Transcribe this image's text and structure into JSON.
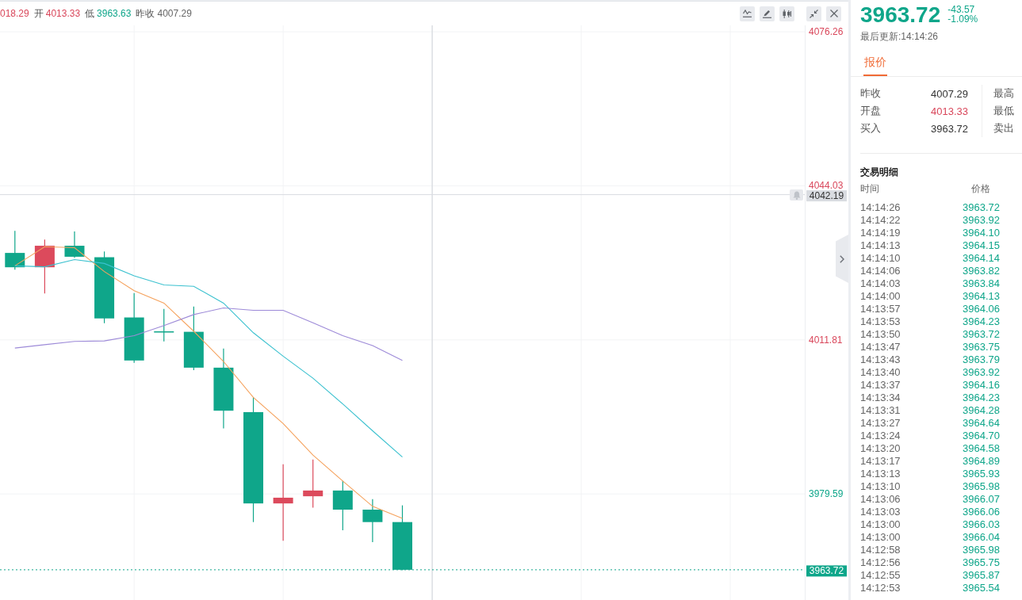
{
  "chart": {
    "quote_bar": [
      {
        "value": "018.29",
        "color": "#d9475b"
      },
      {
        "label": "开",
        "value": "4013.33",
        "color": "#d9475b"
      },
      {
        "label": "低",
        "value": "3963.63",
        "color": "#0fa68a"
      },
      {
        "label": "昨收",
        "value": "4007.29",
        "color": "#666666"
      }
    ],
    "chart_data": [
      {
        "type": "candlestick",
        "categories": [
          null,
          null,
          null,
          null,
          null,
          null,
          null,
          null,
          null,
          null,
          null,
          null,
          null,
          null,
          null,
          null,
          null,
          null,
          null,
          null,
          null,
          null,
          null,
          null,
          null,
          null,
          null
        ],
        "ohlc": [
          [
            4030.0,
            4034.6,
            4026.5,
            4027.0
          ],
          [
            4027.0,
            4032.8,
            4021.5,
            4031.5
          ],
          [
            4031.5,
            4034.5,
            4029.0,
            4029.2
          ],
          [
            4029.1,
            4030.3,
            4015.3,
            4016.3
          ],
          [
            4016.5,
            4021.6,
            4007.0,
            4007.5
          ],
          [
            4013.6,
            4018.3,
            4011.5,
            4013.5
          ],
          [
            4013.5,
            4018.8,
            4005.5,
            4006.0
          ],
          [
            4006.0,
            4010.0,
            3993.3,
            3997.0
          ],
          [
            3996.7,
            3999.8,
            3973.7,
            3977.6
          ],
          [
            3977.6,
            3985.8,
            3969.8,
            3978.8
          ],
          [
            3979.1,
            3986.8,
            3976.7,
            3980.3
          ],
          [
            3980.3,
            3982.3,
            3972.0,
            3976.3
          ],
          [
            3976.3,
            3978.5,
            3969.5,
            3973.7
          ],
          [
            3973.7,
            3977.2,
            3963.63,
            3963.72
          ],
          null,
          null,
          null,
          null,
          null,
          null,
          null,
          null,
          null,
          null,
          null,
          null,
          null
        ],
        "series": [
          {
            "type": "line",
            "color": "#f5a25d",
            "values": [
              4027.3,
              4031.3,
              4031.1,
              4026.1,
              4022.1,
              4019.5,
              4013.6,
              4007.3,
              3999.8,
              3994.3,
              3987.7,
              3982.3,
              3977.0,
              3974.5,
              null,
              null,
              null,
              null,
              null,
              null,
              null,
              null,
              null,
              null,
              null,
              null,
              null
            ]
          },
          {
            "type": "line",
            "color": "#3bc1cf",
            "values": [
              4027.3,
              4027.1,
              4028.6,
              4027.8,
              4025.2,
              4023.3,
              4023.0,
              4019.5,
              4013.3,
              4008.4,
              4003.8,
              3998.4,
              3992.8,
              3987.3,
              null,
              null,
              null,
              null,
              null,
              null,
              null,
              null,
              null,
              null,
              null,
              null,
              null
            ]
          },
          {
            "type": "line",
            "color": "#9d8ad8",
            "values": [
              4010.1,
              4010.8,
              4011.5,
              4011.6,
              4012.7,
              4014.8,
              4017.1,
              4018.5,
              4018.0,
              4018.0,
              4015.4,
              4012.7,
              4010.6,
              4007.5,
              null,
              null,
              null,
              null,
              null,
              null,
              null,
              null,
              null,
              null,
              null,
              null,
              null
            ]
          }
        ],
        "ylim": [
          3957.4,
          4077.6
        ],
        "yticks": [
          {
            "value": 4076.26,
            "label": "4076.26"
          },
          {
            "value": 4044.03,
            "label": "4044.03"
          },
          {
            "value": 4011.81,
            "label": "4011.81"
          },
          {
            "value": 3979.59,
            "label": "3979.59"
          }
        ],
        "grid": true,
        "ref_lines": [
          {
            "axis": "y",
            "value": 4042.19,
            "label": "4042.19",
            "color": "#d9dce1",
            "line_style": "solid"
          },
          {
            "axis": "y",
            "value": 3963.72,
            "label": "3963.72",
            "color": "#0fa68a",
            "line_style": "dotted"
          }
        ]
      }
    ]
  },
  "side_panel": {
    "price": "3963.72",
    "change": "-43.57",
    "change_percent": "-1.09%",
    "color": "#0fa68a",
    "updated": "最后更新:14:14:26",
    "tabs": [
      {
        "label": "报价",
        "selected": true
      }
    ],
    "quote_rows": [
      {
        "label": "昨收",
        "value": "4007.29",
        "color": "#333333"
      },
      {
        "label": "开盘",
        "value": "4013.33",
        "color": "#d9475b"
      },
      {
        "label": "买入",
        "value": "3963.72",
        "color": "#333333"
      }
    ],
    "quote_labels_2": [
      "最高",
      "最低",
      "卖出"
    ],
    "trades": {
      "title": "交易明细",
      "columns": [
        "时间",
        "价格"
      ],
      "rows": [
        {
          "time": "14:14:26",
          "price": "3963.72",
          "color": "#0fa68a"
        },
        {
          "time": "14:14:22",
          "price": "3963.92",
          "color": "#0fa68a"
        },
        {
          "time": "14:14:19",
          "price": "3964.10",
          "color": "#0fa68a"
        },
        {
          "time": "14:14:13",
          "price": "3964.15",
          "color": "#0fa68a"
        },
        {
          "time": "14:14:10",
          "price": "3964.14",
          "color": "#0fa68a"
        },
        {
          "time": "14:14:06",
          "price": "3963.82",
          "color": "#0fa68a"
        },
        {
          "time": "14:14:03",
          "price": "3963.84",
          "color": "#0fa68a"
        },
        {
          "time": "14:14:00",
          "price": "3964.13",
          "color": "#0fa68a"
        },
        {
          "time": "14:13:57",
          "price": "3964.06",
          "color": "#0fa68a"
        },
        {
          "time": "14:13:53",
          "price": "3964.23",
          "color": "#0fa68a"
        },
        {
          "time": "14:13:50",
          "price": "3963.72",
          "color": "#0fa68a"
        },
        {
          "time": "14:13:47",
          "price": "3963.75",
          "color": "#0fa68a"
        },
        {
          "time": "14:13:43",
          "price": "3963.79",
          "color": "#0fa68a"
        },
        {
          "time": "14:13:40",
          "price": "3963.92",
          "color": "#0fa68a"
        },
        {
          "time": "14:13:37",
          "price": "3964.16",
          "color": "#0fa68a"
        },
        {
          "time": "14:13:34",
          "price": "3964.23",
          "color": "#0fa68a"
        },
        {
          "time": "14:13:31",
          "price": "3964.28",
          "color": "#0fa68a"
        },
        {
          "time": "14:13:27",
          "price": "3964.64",
          "color": "#0fa68a"
        },
        {
          "time": "14:13:24",
          "price": "3964.70",
          "color": "#0fa68a"
        },
        {
          "time": "14:13:20",
          "price": "3964.58",
          "color": "#0fa68a"
        },
        {
          "time": "14:13:17",
          "price": "3964.89",
          "color": "#0fa68a"
        },
        {
          "time": "14:13:13",
          "price": "3965.93",
          "color": "#0fa68a"
        },
        {
          "time": "14:13:10",
          "price": "3965.98",
          "color": "#0fa68a"
        },
        {
          "time": "14:13:06",
          "price": "3966.07",
          "color": "#0fa68a"
        },
        {
          "time": "14:13:03",
          "price": "3966.06",
          "color": "#0fa68a"
        },
        {
          "time": "14:13:00",
          "price": "3966.03",
          "color": "#0fa68a"
        },
        {
          "time": "14:13:00",
          "price": "3966.04",
          "color": "#0fa68a"
        },
        {
          "time": "14:12:58",
          "price": "3965.98",
          "color": "#0fa68a"
        },
        {
          "time": "14:12:56",
          "price": "3965.75",
          "color": "#0fa68a"
        },
        {
          "time": "14:12:55",
          "price": "3965.87",
          "color": "#0fa68a"
        },
        {
          "time": "14:12:53",
          "price": "3965.54",
          "color": "#0fa68a"
        }
      ]
    }
  }
}
